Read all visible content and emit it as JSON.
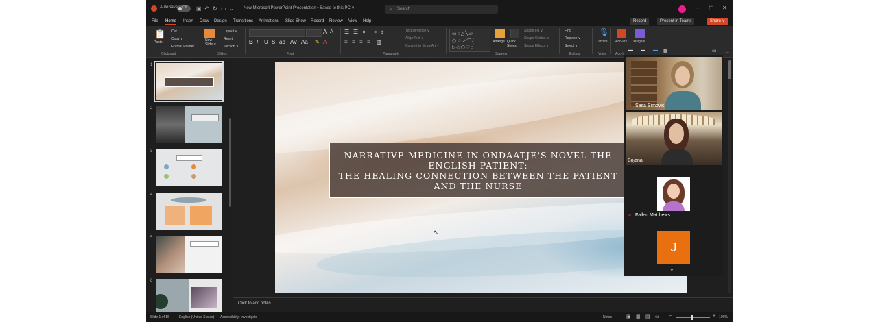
{
  "titlebar": {
    "autosave": "AutoSave",
    "toggle_state": "Off",
    "file_title": "New Microsoft PowerPoint Presentation  •  Saved to this PC ∨",
    "search_placeholder": "Search"
  },
  "menu_tabs": [
    "File",
    "Home",
    "Insert",
    "Draw",
    "Design",
    "Transitions",
    "Animations",
    "Slide Show",
    "Record",
    "Review",
    "View",
    "Help"
  ],
  "actions": {
    "record": "Record",
    "present": "Present in Teams",
    "share": "Share ∨"
  },
  "ribbon": {
    "paste": "Paste",
    "cut": "Cut",
    "copy": "Copy ∨",
    "format_painter": "Format Painter",
    "new_slide": "New Slide ∨",
    "layout": "Layout ∨",
    "reset": "Reset",
    "section": "Section ∨",
    "arrange": "Arrange",
    "quick_styles": "Quick Styles",
    "shape_fill": "Shape Fill ∨",
    "shape_outline": "Shape Outline ∨",
    "shape_effects": "Shape Effects ∨",
    "find": "Find",
    "replace": "Replace ∨",
    "select": "Select ∨",
    "dictate": "Dictate",
    "addins": "Add-ins",
    "designer": "Designer",
    "text_direction": "Text Direction ∨",
    "align_text": "Align Text ∨",
    "convert_smartart": "Convert to SmartArt ∨",
    "groups": {
      "clipboard": "Clipboard",
      "slides": "Slides",
      "font": "Font",
      "paragraph": "Paragraph",
      "drawing": "Drawing",
      "editing": "Editing",
      "voice": "Voice",
      "addins": "Add-in"
    }
  },
  "slides": [
    {
      "num": "1"
    },
    {
      "num": "2"
    },
    {
      "num": "3"
    },
    {
      "num": "4"
    },
    {
      "num": "5"
    },
    {
      "num": "6"
    }
  ],
  "slide": {
    "title": "NARRATIVE MEDICINE IN ONDAATJE'S NOVEL THE ENGLISH PATIENT:\nTHE HEALING CONNECTION BETWEEN THE PATIENT AND THE NURSE"
  },
  "notes_placeholder": "Click to add notes",
  "status": {
    "slide_count": "Slide 1 of 16",
    "language": "English (United States)",
    "accessibility": "Accessibility: Investigate",
    "notes": "Notes",
    "zoom": "106%"
  },
  "meeting": {
    "participants": [
      {
        "name": "Sasa Simovic"
      },
      {
        "name": "Bojana"
      },
      {
        "name": "Fallen Matthews"
      },
      {
        "name": "J",
        "initial": "J"
      }
    ]
  },
  "colors": {
    "accent": "#d24726",
    "avatar": "#e8700e",
    "mic_muted": "#e03b3b"
  }
}
